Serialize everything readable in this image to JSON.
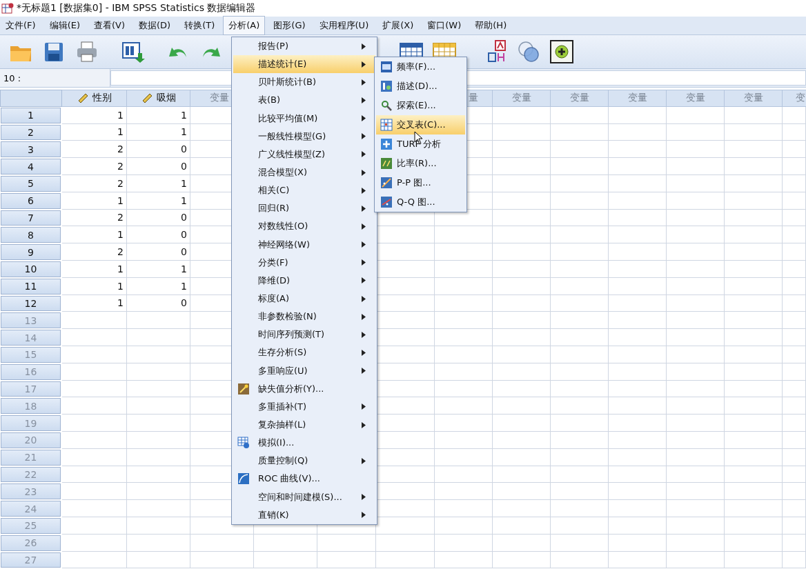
{
  "window": {
    "title": "*无标题1 [数据集0] - IBM SPSS Statistics 数据编辑器"
  },
  "menu_bar": [
    {
      "label": "文件(F)",
      "selected": false
    },
    {
      "label": "编辑(E)",
      "selected": false
    },
    {
      "label": "查看(V)",
      "selected": false
    },
    {
      "label": "数据(D)",
      "selected": false
    },
    {
      "label": "转换(T)",
      "selected": false
    },
    {
      "label": "分析(A)",
      "selected": true
    },
    {
      "label": "图形(G)",
      "selected": false
    },
    {
      "label": "实用程序(U)",
      "selected": false
    },
    {
      "label": "扩展(X)",
      "selected": false
    },
    {
      "label": "窗口(W)",
      "selected": false
    },
    {
      "label": "帮助(H)",
      "selected": false
    }
  ],
  "cell_reference": {
    "label": "10 :"
  },
  "columns": [
    {
      "kind": "variable",
      "label": "性别"
    },
    {
      "kind": "variable",
      "label": "吸烟"
    },
    {
      "kind": "cut_right",
      "label": "变量"
    },
    {
      "kind": "hidden"
    },
    {
      "kind": "hidden"
    },
    {
      "kind": "hidden"
    },
    {
      "kind": "cut_left",
      "label": "量"
    },
    {
      "kind": "placeholder",
      "label": "变量"
    },
    {
      "kind": "placeholder",
      "label": "变量"
    },
    {
      "kind": "placeholder",
      "label": "变量"
    },
    {
      "kind": "placeholder",
      "label": "变量"
    },
    {
      "kind": "placeholder",
      "label": "变量"
    },
    {
      "kind": "edge",
      "label": "变"
    }
  ],
  "rows": [
    {
      "number": "1",
      "cells": [
        "1",
        "1"
      ]
    },
    {
      "number": "2",
      "cells": [
        "1",
        "1"
      ]
    },
    {
      "number": "3",
      "cells": [
        "2",
        "0"
      ]
    },
    {
      "number": "4",
      "cells": [
        "2",
        "0"
      ]
    },
    {
      "number": "5",
      "cells": [
        "2",
        "1"
      ]
    },
    {
      "number": "6",
      "cells": [
        "1",
        "1"
      ]
    },
    {
      "number": "7",
      "cells": [
        "2",
        "0"
      ]
    },
    {
      "number": "8",
      "cells": [
        "1",
        "0"
      ]
    },
    {
      "number": "9",
      "cells": [
        "2",
        "0"
      ]
    },
    {
      "number": "10",
      "cells": [
        "1",
        "1"
      ]
    },
    {
      "number": "11",
      "cells": [
        "1",
        "1"
      ]
    },
    {
      "number": "12",
      "cells": [
        "1",
        "0"
      ]
    },
    {
      "number": "13"
    },
    {
      "number": "14"
    },
    {
      "number": "15"
    },
    {
      "number": "16"
    },
    {
      "number": "17"
    },
    {
      "number": "18"
    },
    {
      "number": "19"
    },
    {
      "number": "20"
    },
    {
      "number": "21"
    },
    {
      "number": "22"
    },
    {
      "number": "23"
    },
    {
      "number": "24"
    },
    {
      "number": "25"
    },
    {
      "number": "26"
    },
    {
      "number": "27"
    }
  ],
  "analyze_menu": {
    "items": [
      {
        "label": "报告(P)",
        "kind": "submenu",
        "selected": false
      },
      {
        "label": "描述统计(E)",
        "kind": "submenu",
        "selected": true
      },
      {
        "label": "贝叶斯统计(B)",
        "kind": "submenu",
        "selected": false
      },
      {
        "label": "表(B)",
        "kind": "submenu",
        "selected": false
      },
      {
        "label": "比较平均值(M)",
        "kind": "submenu",
        "selected": false
      },
      {
        "label": "一般线性模型(G)",
        "kind": "submenu",
        "selected": false
      },
      {
        "label": "广义线性模型(Z)",
        "kind": "submenu",
        "selected": false
      },
      {
        "label": "混合模型(X)",
        "kind": "submenu",
        "selected": false
      },
      {
        "label": "相关(C)",
        "kind": "submenu",
        "selected": false
      },
      {
        "label": "回归(R)",
        "kind": "submenu",
        "selected": false
      },
      {
        "label": "对数线性(O)",
        "kind": "submenu",
        "selected": false
      },
      {
        "label": "神经网络(W)",
        "kind": "submenu",
        "selected": false
      },
      {
        "label": "分类(F)",
        "kind": "submenu",
        "selected": false
      },
      {
        "label": "降维(D)",
        "kind": "submenu",
        "selected": false
      },
      {
        "label": "标度(A)",
        "kind": "submenu",
        "selected": false
      },
      {
        "label": "非参数检验(N)",
        "kind": "submenu",
        "selected": false
      },
      {
        "label": "时间序列预测(T)",
        "kind": "submenu",
        "selected": false
      },
      {
        "label": "生存分析(S)",
        "kind": "submenu",
        "selected": false
      },
      {
        "label": "多重响应(U)",
        "kind": "submenu",
        "selected": false
      },
      {
        "label": "缺失值分析(Y)...",
        "kind": "dialog",
        "selected": false
      },
      {
        "label": "多重插补(T)",
        "kind": "submenu",
        "selected": false
      },
      {
        "label": "复杂抽样(L)",
        "kind": "submenu",
        "selected": false
      },
      {
        "label": "模拟(I)...",
        "kind": "dialog",
        "selected": false
      },
      {
        "label": "质量控制(Q)",
        "kind": "submenu",
        "selected": false
      },
      {
        "label": "ROC 曲线(V)...",
        "kind": "dialog",
        "selected": false
      },
      {
        "label": "空间和时间建模(S)...",
        "kind": "submenu",
        "selected": false
      },
      {
        "label": "直销(K)",
        "kind": "submenu",
        "selected": false
      }
    ]
  },
  "descriptives_menu": {
    "items": [
      {
        "label": "频率(F)...",
        "selected": false
      },
      {
        "label": "描述(D)...",
        "selected": false
      },
      {
        "label": "探索(E)...",
        "selected": false
      },
      {
        "label": "交叉表(C)...",
        "selected": true
      },
      {
        "label": "TURF 分析",
        "selected": false
      },
      {
        "label": "比率(R)...",
        "selected": false
      },
      {
        "label": "P-P 图...",
        "selected": false
      },
      {
        "label": "Q-Q 图...",
        "selected": false
      }
    ]
  }
}
